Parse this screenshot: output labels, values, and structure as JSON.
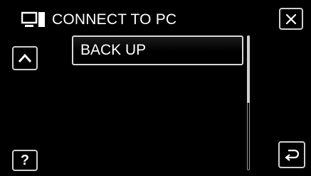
{
  "header": {
    "title": "CONNECT TO PC",
    "icon": "pc-connection-icon"
  },
  "buttons": {
    "close_icon": "close-icon",
    "up_icon": "chevron-up-icon",
    "help_label": "?",
    "back_icon": "return-icon"
  },
  "menu": {
    "items": [
      {
        "label": "BACK UP"
      }
    ]
  },
  "scrollbar": {
    "position": 0,
    "visible_fraction": 0.5
  },
  "colors": {
    "background": "#000000",
    "text": "#ffffff",
    "border": "#cfcfcf"
  }
}
